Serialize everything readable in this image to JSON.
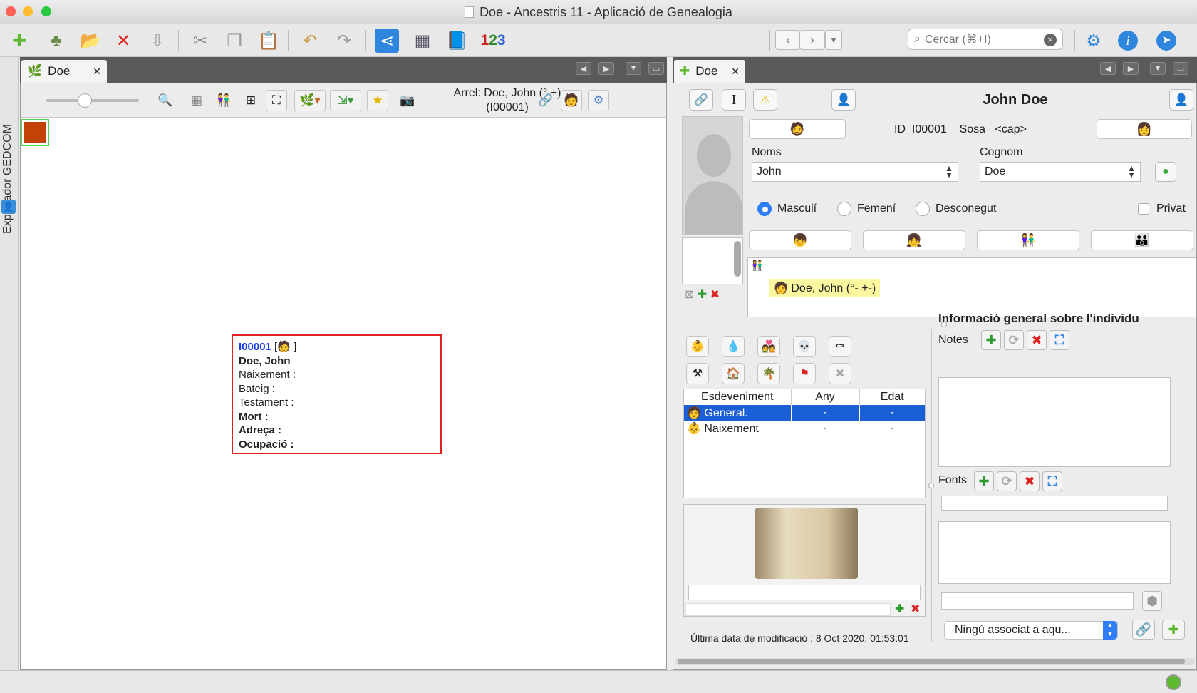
{
  "window": {
    "title": "Doe - Ancestris 11 - Aplicació de Genealogia"
  },
  "search": {
    "placeholder": "Cercar (⌘+I)"
  },
  "sidebar": {
    "label": "Explorador GEDCOM"
  },
  "left_tab": {
    "label": "Doe"
  },
  "right_tab": {
    "label": "Doe"
  },
  "tree_toolbar": {
    "root_label": "Arrel: Doe, John (° +) (I00001)"
  },
  "card": {
    "id": "I00001",
    "name": "Doe, John",
    "rows": [
      "Naixement  :",
      "Bateig :",
      "Testament :"
    ],
    "bold_rows": [
      "Mort  :",
      "Adreça  :",
      "Ocupació  :"
    ]
  },
  "individual": {
    "header_name": "John Doe",
    "id_label": "ID",
    "id_value": "I00001",
    "sosa_label": "Sosa",
    "sosa_value": "<cap>",
    "given_label": "Noms",
    "given_value": "John",
    "surname_label": "Cognom",
    "surname_value": "Doe",
    "sex_options": [
      "Masculí",
      "Femení",
      "Desconegut"
    ],
    "sex_selected": "Masculí",
    "private_label": "Privat",
    "family_entry": "Doe, John (°- +-)"
  },
  "events": {
    "columns": [
      "Esdeveniment",
      "Any",
      "Edat"
    ],
    "rows": [
      {
        "name": "General.",
        "year": "-",
        "age": "-",
        "selected": true
      },
      {
        "name": "Naixement",
        "year": "-",
        "age": "-",
        "selected": false
      }
    ]
  },
  "info": {
    "title": "Informació general sobre l'individu",
    "notes_label": "Notes",
    "sources_label": "Fonts",
    "assoc_select": "Ningú associat a aqu...",
    "modified": "Última data de modificació : 8 Oct 2020, 01:53:01"
  },
  "colors": {
    "accent": "#2f7ef7",
    "selection": "#1a5fd6",
    "card_border": "#e02020",
    "id_blue": "#1a3ee8",
    "highlight": "#fbf6a0"
  }
}
